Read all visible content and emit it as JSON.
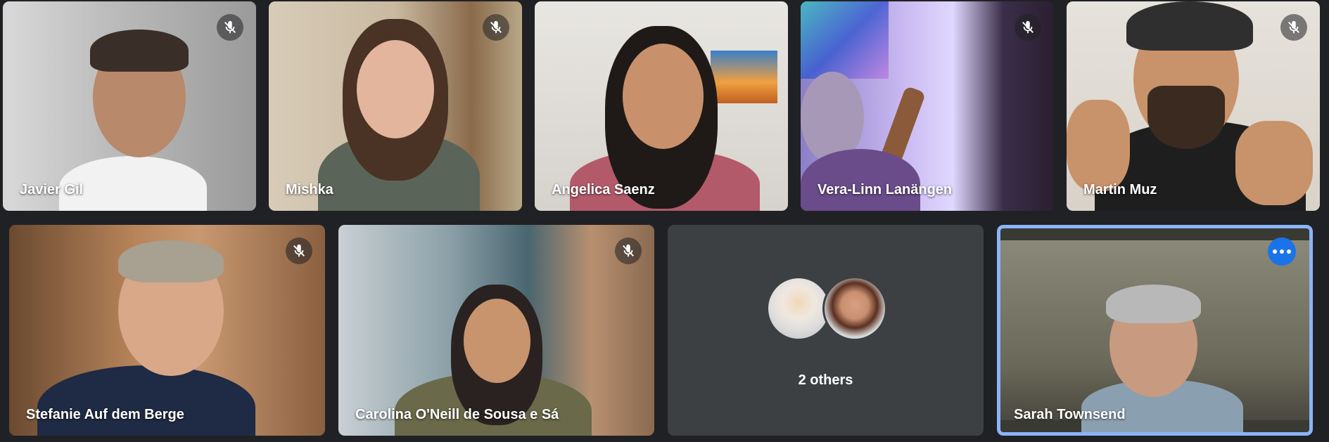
{
  "participants": [
    {
      "name": "Javier Gil",
      "muted": true
    },
    {
      "name": "Mishka",
      "muted": true
    },
    {
      "name": "Angelica Saenz",
      "muted": false
    },
    {
      "name": "Vera-Linn Lanängen",
      "muted": true
    },
    {
      "name": "Martin Muz",
      "muted": true
    },
    {
      "name": "Stefanie Auf dem Berge",
      "muted": true
    },
    {
      "name": "Carolina O'Neill de Sousa e Sá",
      "muted": true
    },
    {
      "name": "Sarah Townsend",
      "muted": false,
      "active_speaker": true
    }
  ],
  "others": {
    "label": "2 others"
  },
  "icons": {
    "mute": "mic-off-icon",
    "more": "more-options-icon"
  },
  "colors": {
    "background": "#202124",
    "tile": "#3c4043",
    "active_border": "#8ab4f8",
    "more_button": "#1a73e8"
  }
}
